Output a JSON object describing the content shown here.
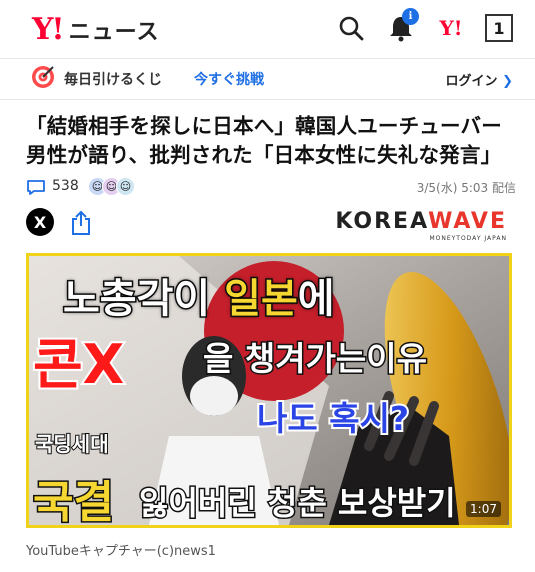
{
  "header": {
    "logo_mark": "Y!",
    "logo_text": "ニュース",
    "notification_badge": "i",
    "account_logo": "Y!",
    "tab_count": "1",
    "icons": [
      "search-icon",
      "bell-icon",
      "yahoo-logo-icon",
      "tabs-icon"
    ]
  },
  "lottery": {
    "label": "毎日引けるくじ",
    "cta": "今すぐ挑戦",
    "login": "ログイン"
  },
  "article": {
    "title_line1": "「結婚相手を探しに日本へ」韓国人ユーチューバー",
    "title_line2": "男性が語り、批判された「日本女性に失礼な発言」",
    "comment_count": "538",
    "date": "3/5(水) 5:03 配信"
  },
  "share": {
    "x_label": "X",
    "source_logo_a": "KOREA",
    "source_logo_b": "WAVE",
    "source_logo_sub": "MONEYTODAY JAPAN"
  },
  "video": {
    "line1_a": "노총각이 ",
    "line1_b": "일본",
    "line1_c": "에",
    "line2": "콘X",
    "line3": "을 챙겨가는이유",
    "line4": "나도 혹시?",
    "line5": "국딩세대",
    "line6": "국결",
    "line7": "잃어버린 청춘 보상받기",
    "duration": "1:07"
  },
  "caption": "YouTubeキャプチャー(c)news1",
  "colors": {
    "brand_red": "#ff0033",
    "link_blue": "#1f6fe5",
    "thumb_border": "#f0d318"
  }
}
